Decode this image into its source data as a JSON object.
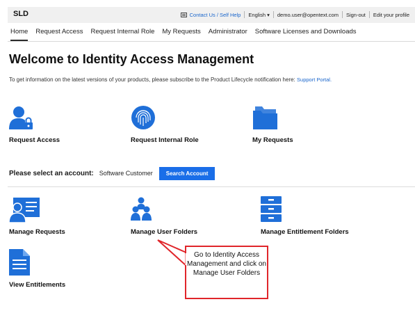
{
  "topbar": {
    "logo": "SLD",
    "contact": "Contact Us / Self Help",
    "language": "English ▾",
    "user": "demo.user@opentext.com",
    "signout": "Sign-out",
    "edit_profile": "Edit your profile"
  },
  "nav": [
    "Home",
    "Request Access",
    "Request Internal Role",
    "My Requests",
    "Administrator",
    "Software Licenses and Downloads"
  ],
  "page": {
    "title": "Welcome to Identity Access Management",
    "info": "To get information on the latest versions of your products, please subscribe to the Product Lifecycle notification here:",
    "info_link": "Support Portal."
  },
  "tiles_top": {
    "request_access": "Request Access",
    "request_internal_role": "Request Internal Role",
    "my_requests": "My Requests"
  },
  "account": {
    "prompt": "Please select an account:",
    "value": "Software Customer",
    "button": "Search Account"
  },
  "tiles_bottom": {
    "manage_requests": "Manage Requests",
    "manage_user_folders": "Manage User Folders",
    "manage_entitlement_folders": "Manage Entitlement Folders",
    "view_entitlements": "View Entitlements"
  },
  "callout": {
    "text": "Go to Identity Access Management and click on Manage User Folders"
  },
  "colors": {
    "accent": "#1a6ee8",
    "icon": "#1f6fd8",
    "callout_border": "#e0252a"
  }
}
